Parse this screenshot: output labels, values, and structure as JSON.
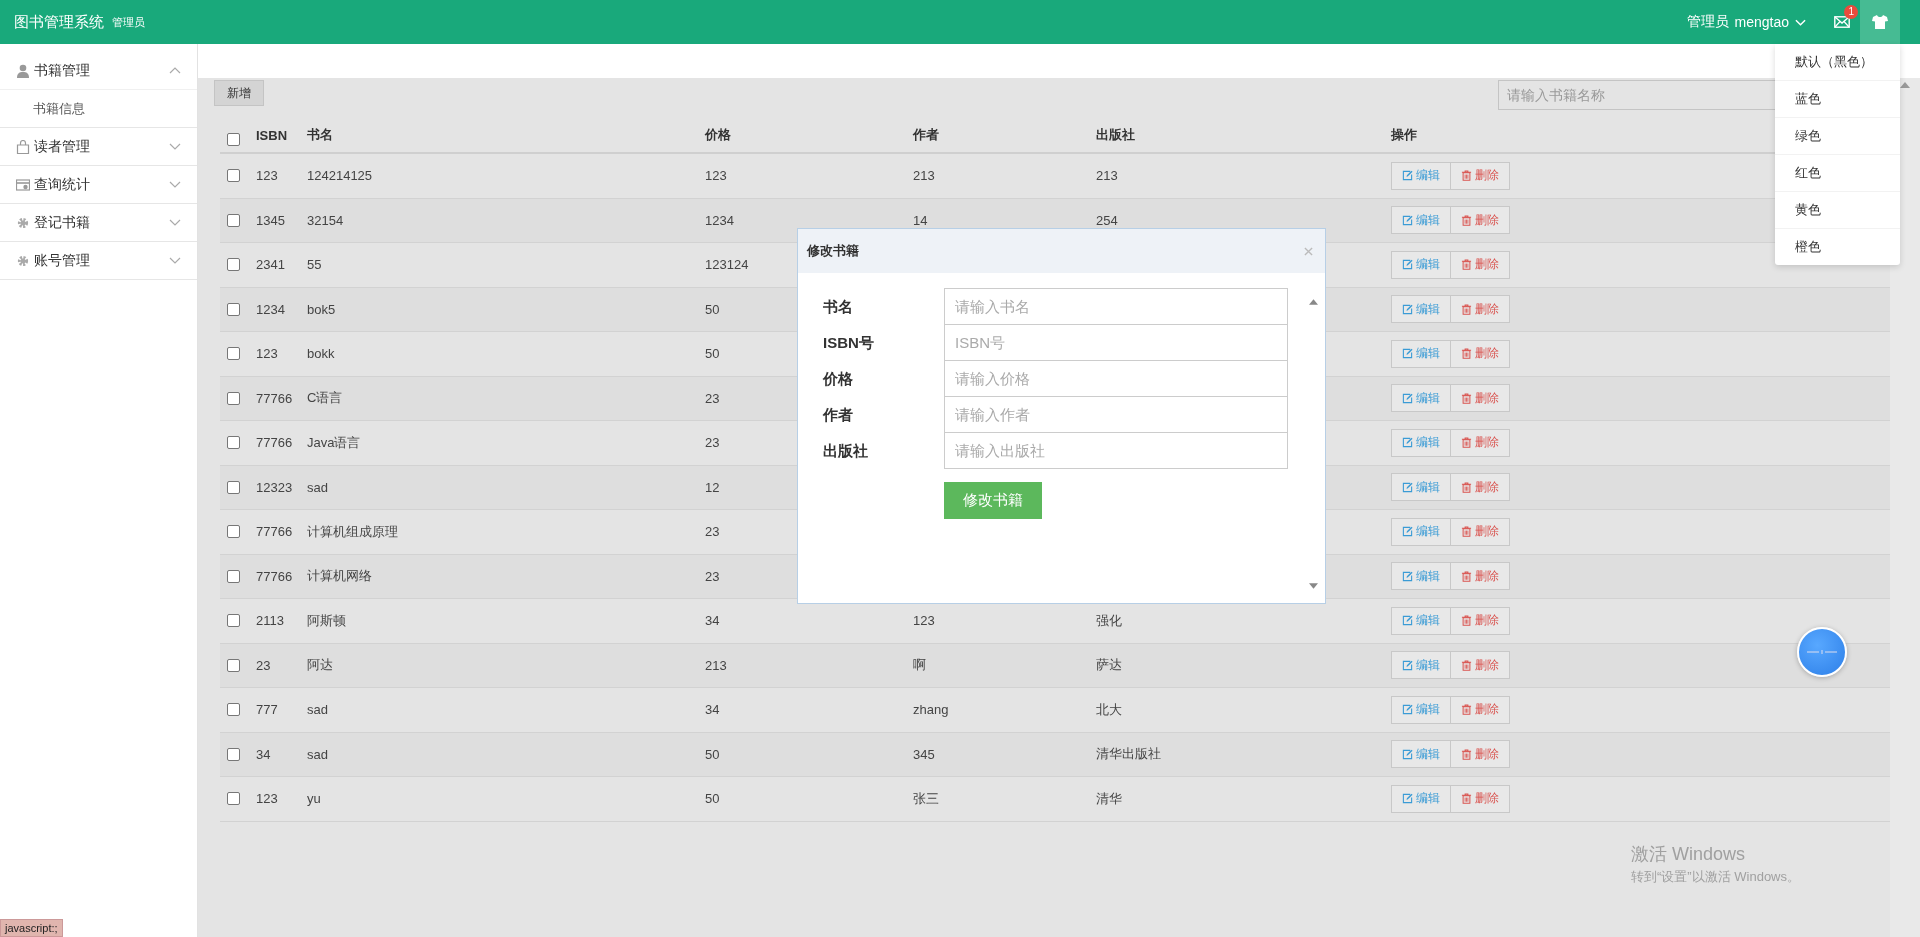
{
  "app": {
    "title": "图书管理系统",
    "role_badge": "管理员"
  },
  "user_menu": {
    "role": "管理员",
    "username": "mengtao"
  },
  "notifications": {
    "count": "1"
  },
  "theme_menu": {
    "open": true,
    "options": [
      {
        "label": "默认（黑色）"
      },
      {
        "label": "蓝色"
      },
      {
        "label": "绿色"
      },
      {
        "label": "红色"
      },
      {
        "label": "黄色"
      },
      {
        "label": "橙色"
      }
    ]
  },
  "sidebar": {
    "items": [
      {
        "label": "书籍管理",
        "expanded": true,
        "children": [
          {
            "label": "书籍信息"
          }
        ]
      },
      {
        "label": "读者管理",
        "expanded": false
      },
      {
        "label": "查询统计",
        "expanded": false
      },
      {
        "label": "登记书籍",
        "expanded": false
      },
      {
        "label": "账号管理",
        "expanded": false
      }
    ]
  },
  "toolbar": {
    "add_button": "新增",
    "search": {
      "placeholder": "请输入书籍名称"
    }
  },
  "table": {
    "select_all": {
      "checked": false
    },
    "columns": [
      "ISBN",
      "书名",
      "价格",
      "作者",
      "出版社",
      "操作"
    ],
    "rows": [
      {
        "checked": false,
        "isbn": "123",
        "title": "124214125",
        "price": "123",
        "author": "213",
        "publisher": "213",
        "edit": "编辑",
        "delete": "删除"
      },
      {
        "checked": false,
        "isbn": "1345",
        "title": "32154",
        "price": "1234",
        "author": "14",
        "publisher": "254",
        "edit": "编辑",
        "delete": "删除"
      },
      {
        "checked": false,
        "isbn": "2341",
        "title": "55",
        "price": "123124",
        "edit": "编辑",
        "delete": "删除"
      },
      {
        "checked": false,
        "isbn": "1234",
        "title": "bok5",
        "price": "50",
        "edit": "编辑",
        "delete": "删除"
      },
      {
        "checked": false,
        "isbn": "123",
        "title": "bokk",
        "price": "50",
        "edit": "编辑",
        "delete": "删除"
      },
      {
        "checked": false,
        "isbn": "77766",
        "title": "C语言",
        "price": "23",
        "edit": "编辑",
        "delete": "删除"
      },
      {
        "checked": false,
        "isbn": "77766",
        "title": "Java语言",
        "price": "23",
        "edit": "编辑",
        "delete": "删除"
      },
      {
        "checked": false,
        "isbn": "12323",
        "title": "sad",
        "price": "12",
        "edit": "编辑",
        "delete": "删除"
      },
      {
        "checked": false,
        "isbn": "77766",
        "title": "计算机组成原理",
        "price": "23",
        "edit": "编辑",
        "delete": "删除"
      },
      {
        "checked": false,
        "isbn": "77766",
        "title": "计算机网络",
        "price": "23",
        "edit": "编辑",
        "delete": "删除"
      },
      {
        "checked": false,
        "isbn": "2113",
        "title": "阿斯顿",
        "price": "34",
        "author": "123",
        "publisher": "强化",
        "edit": "编辑",
        "delete": "删除"
      },
      {
        "checked": false,
        "isbn": "23",
        "title": "阿达",
        "price": "213",
        "author": "啊",
        "publisher": "萨达",
        "edit": "编辑",
        "delete": "删除"
      },
      {
        "checked": false,
        "isbn": "777",
        "title": "sad",
        "price": "34",
        "author": "zhang",
        "publisher": "北大",
        "edit": "编辑",
        "delete": "删除"
      },
      {
        "checked": false,
        "isbn": "34",
        "title": "sad",
        "price": "50",
        "author": "345",
        "publisher": "清华出版社",
        "edit": "编辑",
        "delete": "删除"
      },
      {
        "checked": false,
        "isbn": "123",
        "title": "yu",
        "price": "50",
        "author": "张三",
        "publisher": "清华",
        "edit": "编辑",
        "delete": "删除"
      }
    ]
  },
  "modal": {
    "title": "修改书籍",
    "fields": [
      {
        "label": "书名",
        "placeholder": "请输入书名"
      },
      {
        "label": "ISBN号",
        "placeholder": "ISBN号"
      },
      {
        "label": "价格",
        "placeholder": "请输入价格"
      },
      {
        "label": "作者",
        "placeholder": "请输入作者"
      },
      {
        "label": "出版社",
        "placeholder": "请输入出版社"
      }
    ],
    "submit": "修改书籍"
  },
  "windows_activation": {
    "title": "激活 Windows",
    "subtitle": "转到“设置”以激活 Windows。"
  },
  "status_bar": {
    "url": "javascript:;"
  }
}
